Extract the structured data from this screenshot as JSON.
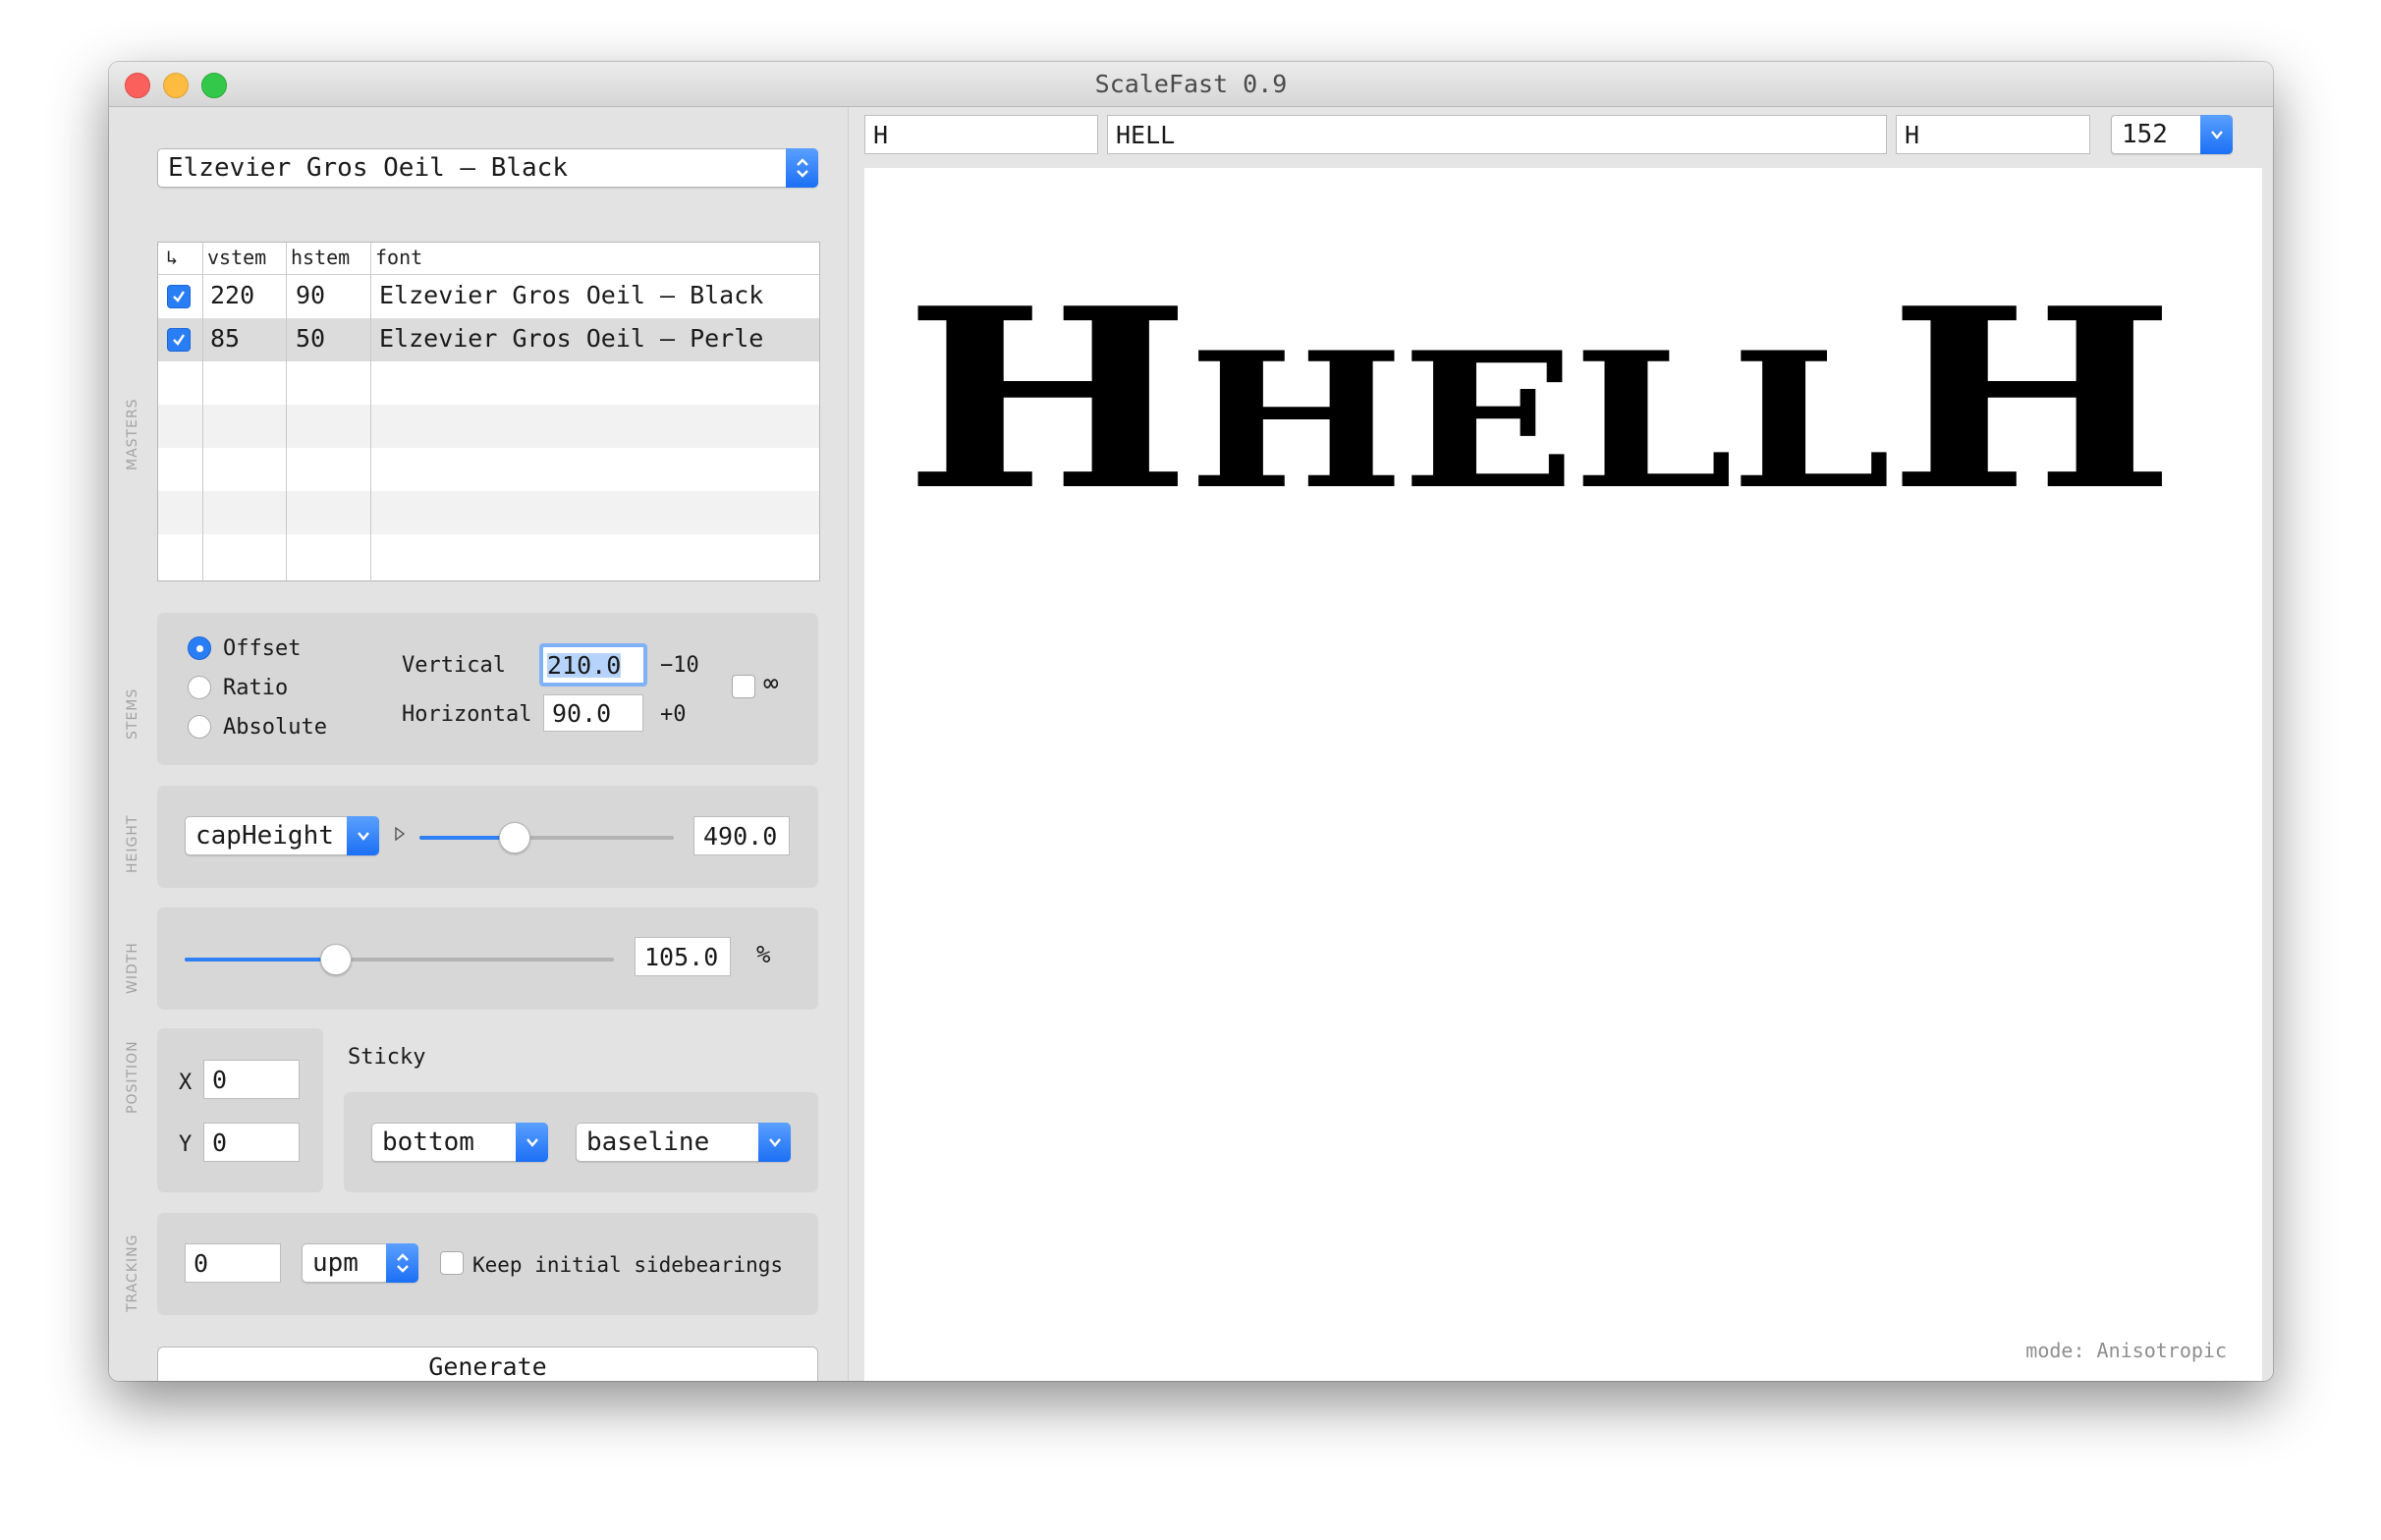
{
  "window": {
    "title": "ScaleFast 0.9"
  },
  "font_select": {
    "value": "Elzevier Gros Oeil — Black"
  },
  "masters": {
    "section_label": "MASTERS",
    "header_icon": "↳",
    "columns": [
      "vstem",
      "hstem",
      "font"
    ],
    "rows": [
      {
        "checked": true,
        "vstem": "220",
        "hstem": "90",
        "font": "Elzevier Gros Oeil — Black"
      },
      {
        "checked": true,
        "vstem": "85",
        "hstem": "50",
        "font": "Elzevier Gros Oeil — Perle"
      }
    ]
  },
  "stems": {
    "section_label": "STEMS",
    "modes": [
      "Offset",
      "Ratio",
      "Absolute"
    ],
    "selected_mode": "Offset",
    "vertical_label": "Vertical",
    "vertical_value": "210.0",
    "vertical_delta": "−10",
    "horizontal_label": "Horizontal",
    "horizontal_value": "90.0",
    "horizontal_delta": "+0",
    "infinity_symbol": "∞"
  },
  "height": {
    "section_label": "HEIGHT",
    "select_value": "capHeight",
    "value": "490.0",
    "slider_fraction": 0.37
  },
  "width": {
    "section_label": "WIDTH",
    "value": "105.0",
    "unit": "%",
    "slider_fraction": 0.35
  },
  "position": {
    "section_label": "POSITION",
    "x_label": "X",
    "x_value": "0",
    "y_label": "Y",
    "y_value": "0",
    "sticky_label": "Sticky",
    "sticky_vertical": "bottom",
    "sticky_reference": "baseline"
  },
  "tracking": {
    "section_label": "TRACKING",
    "value": "0",
    "unit": "upm",
    "keep_sidebearings_label": "Keep initial sidebearings"
  },
  "generate_label": "Generate",
  "preview": {
    "left_context": "H",
    "text": "HELL",
    "right_context": "H",
    "size": "152",
    "rendered_lead": "H",
    "rendered_body": "HELL",
    "rendered_tail": "H",
    "mode_text": "mode: Anisotropic"
  },
  "colors": {
    "accent": "#2a7ef5",
    "selected_row": "#dcdcdc"
  }
}
